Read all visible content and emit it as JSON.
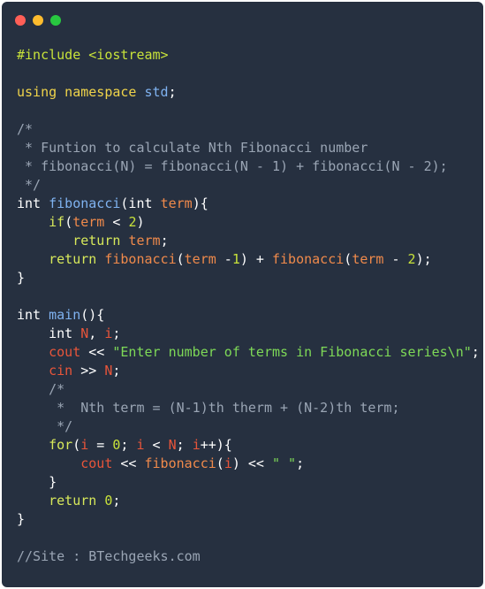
{
  "window": {
    "controls": [
      {
        "name": "close-dot",
        "color": "#ff5f57"
      },
      {
        "name": "minimize-dot",
        "color": "#febc2e"
      },
      {
        "name": "maximize-dot",
        "color": "#28c840"
      }
    ]
  },
  "code": {
    "lines": [
      [
        {
          "t": "#include <iostream>",
          "k": "preproc"
        }
      ],
      [],
      [
        {
          "t": "using namespace",
          "k": "using"
        },
        {
          "t": " ",
          "k": "text"
        },
        {
          "t": "std",
          "k": "std"
        },
        {
          "t": ";",
          "k": "punct"
        }
      ],
      [],
      [
        {
          "t": "/*",
          "k": "comment"
        }
      ],
      [
        {
          "t": " * Funtion to calculate Nth Fibonacci number",
          "k": "comment"
        }
      ],
      [
        {
          "t": " * fibonacci(N) = fibonacci(N - 1) + fibonacci(N - 2);",
          "k": "comment"
        }
      ],
      [
        {
          "t": " */",
          "k": "comment"
        }
      ],
      [
        {
          "t": "int ",
          "k": "keyword"
        },
        {
          "t": "fibonacci",
          "k": "func"
        },
        {
          "t": "(int ",
          "k": "punct"
        },
        {
          "t": "term",
          "k": "param"
        },
        {
          "t": "){",
          "k": "punct"
        }
      ],
      [
        {
          "t": "    ",
          "k": "text"
        },
        {
          "t": "if",
          "k": "ctrl"
        },
        {
          "t": "(",
          "k": "punct"
        },
        {
          "t": "term",
          "k": "param"
        },
        {
          "t": " < ",
          "k": "punct"
        },
        {
          "t": "2",
          "k": "number"
        },
        {
          "t": ")",
          "k": "punct"
        }
      ],
      [
        {
          "t": "       ",
          "k": "text"
        },
        {
          "t": "return ",
          "k": "ctrl"
        },
        {
          "t": "term",
          "k": "param"
        },
        {
          "t": ";",
          "k": "punct"
        }
      ],
      [
        {
          "t": "    ",
          "k": "text"
        },
        {
          "t": "return ",
          "k": "ctrl"
        },
        {
          "t": "fibonacci",
          "k": "func2"
        },
        {
          "t": "(",
          "k": "punct"
        },
        {
          "t": "term",
          "k": "param"
        },
        {
          "t": " -",
          "k": "punct"
        },
        {
          "t": "1",
          "k": "number"
        },
        {
          "t": ") + ",
          "k": "punct"
        },
        {
          "t": "fibonacci",
          "k": "func2"
        },
        {
          "t": "(",
          "k": "punct"
        },
        {
          "t": "term",
          "k": "param"
        },
        {
          "t": " - ",
          "k": "punct"
        },
        {
          "t": "2",
          "k": "number"
        },
        {
          "t": ");",
          "k": "punct"
        }
      ],
      [
        {
          "t": "}",
          "k": "punct"
        }
      ],
      [],
      [
        {
          "t": "int ",
          "k": "keyword"
        },
        {
          "t": "main",
          "k": "func"
        },
        {
          "t": "(){",
          "k": "punct"
        }
      ],
      [
        {
          "t": "    ",
          "k": "text"
        },
        {
          "t": "int ",
          "k": "keyword"
        },
        {
          "t": "N",
          "k": "var"
        },
        {
          "t": ", ",
          "k": "punct"
        },
        {
          "t": "i",
          "k": "var"
        },
        {
          "t": ";",
          "k": "punct"
        }
      ],
      [
        {
          "t": "    ",
          "k": "text"
        },
        {
          "t": "cout",
          "k": "var"
        },
        {
          "t": " << ",
          "k": "punct"
        },
        {
          "t": "\"Enter number of terms in Fibonacci series\\n\"",
          "k": "string"
        },
        {
          "t": ";",
          "k": "punct"
        }
      ],
      [
        {
          "t": "    ",
          "k": "text"
        },
        {
          "t": "cin",
          "k": "var"
        },
        {
          "t": " >> ",
          "k": "punct"
        },
        {
          "t": "N",
          "k": "var"
        },
        {
          "t": ";",
          "k": "punct"
        }
      ],
      [
        {
          "t": "    /*",
          "k": "comment"
        }
      ],
      [
        {
          "t": "     *  Nth term = (N-1)th therm + (N-2)th term;",
          "k": "comment"
        }
      ],
      [
        {
          "t": "     */",
          "k": "comment"
        }
      ],
      [
        {
          "t": "    ",
          "k": "text"
        },
        {
          "t": "for",
          "k": "ctrl"
        },
        {
          "t": "(",
          "k": "punct"
        },
        {
          "t": "i",
          "k": "var"
        },
        {
          "t": " = ",
          "k": "punct"
        },
        {
          "t": "0",
          "k": "number"
        },
        {
          "t": "; ",
          "k": "punct"
        },
        {
          "t": "i",
          "k": "var"
        },
        {
          "t": " < ",
          "k": "punct"
        },
        {
          "t": "N",
          "k": "var"
        },
        {
          "t": "; ",
          "k": "punct"
        },
        {
          "t": "i",
          "k": "var"
        },
        {
          "t": "++){",
          "k": "punct"
        }
      ],
      [
        {
          "t": "        ",
          "k": "text"
        },
        {
          "t": "cout",
          "k": "var"
        },
        {
          "t": " << ",
          "k": "punct"
        },
        {
          "t": "fibonacci",
          "k": "func2"
        },
        {
          "t": "(",
          "k": "punct"
        },
        {
          "t": "i",
          "k": "var"
        },
        {
          "t": ") << ",
          "k": "punct"
        },
        {
          "t": "\" \"",
          "k": "string"
        },
        {
          "t": ";",
          "k": "punct"
        }
      ],
      [
        {
          "t": "    }",
          "k": "punct"
        }
      ],
      [
        {
          "t": "    ",
          "k": "text"
        },
        {
          "t": "return ",
          "k": "ctrl"
        },
        {
          "t": "0",
          "k": "number"
        },
        {
          "t": ";",
          "k": "punct"
        }
      ],
      [
        {
          "t": "}",
          "k": "punct"
        }
      ],
      [],
      [
        {
          "t": "//Site : BTechgeeks.com",
          "k": "comment"
        }
      ]
    ]
  }
}
